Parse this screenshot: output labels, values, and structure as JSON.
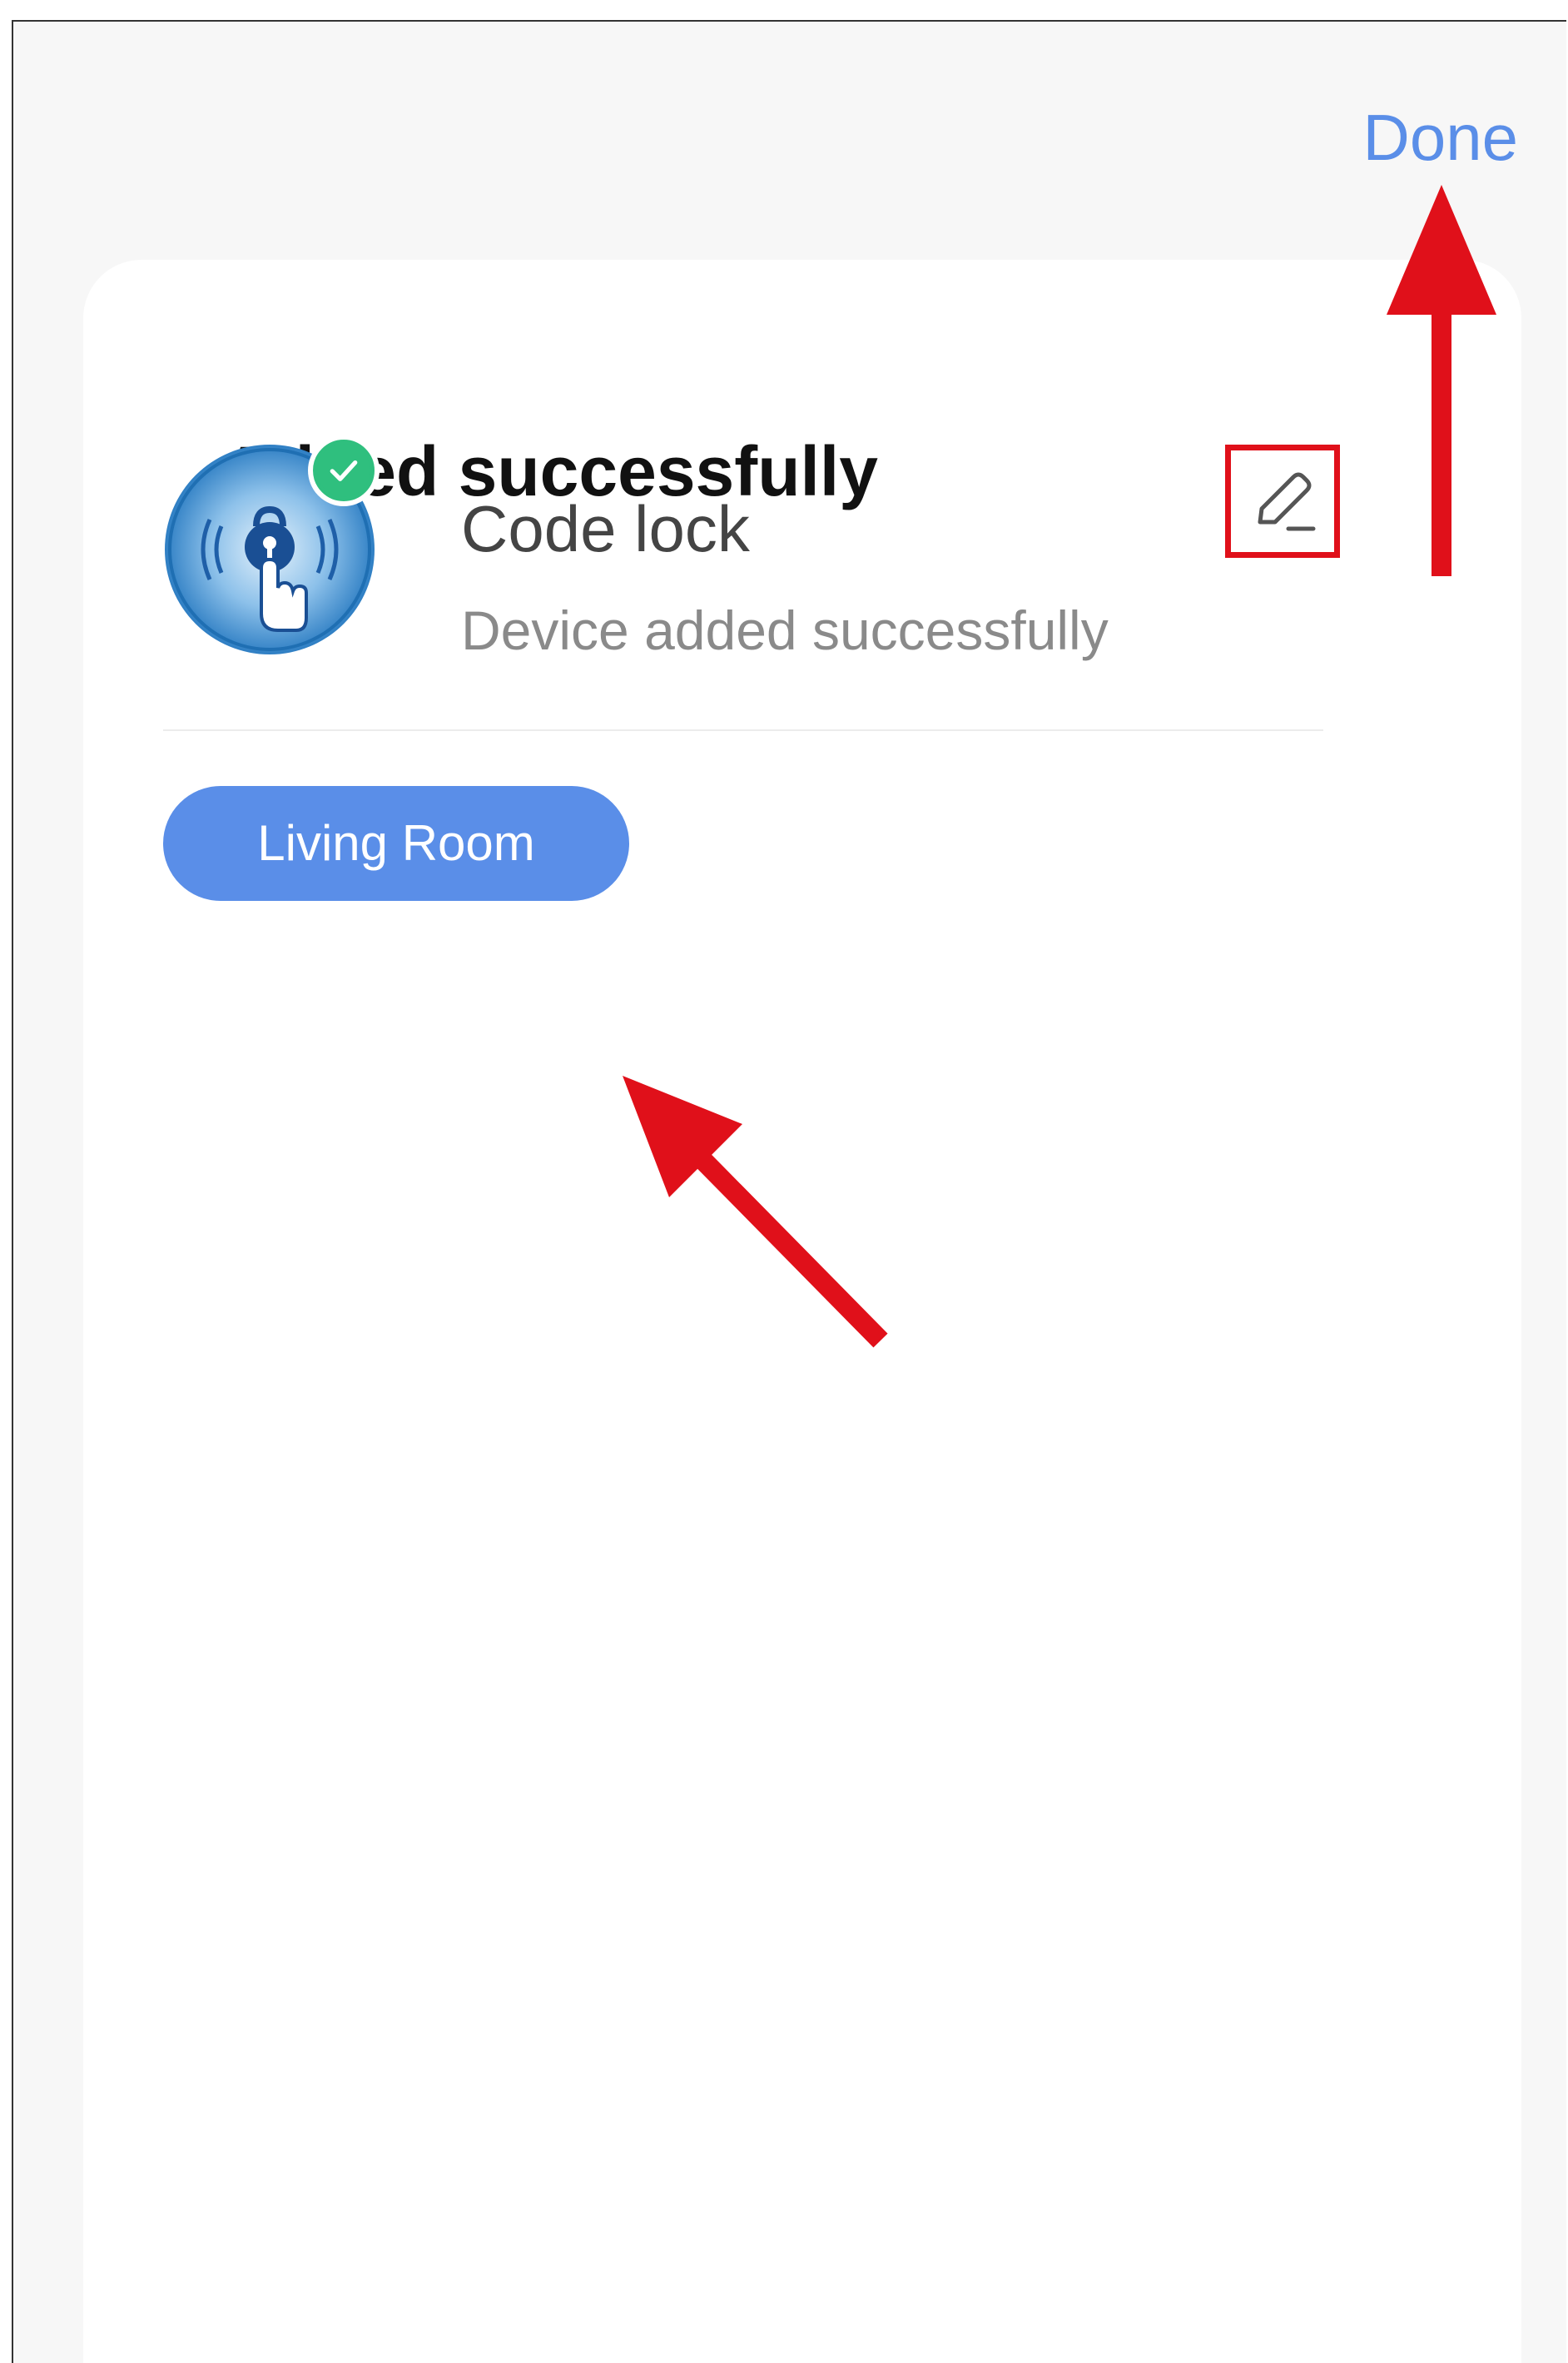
{
  "header": {
    "done_label": "Done"
  },
  "card": {
    "title": "Added successfully",
    "device": {
      "name": "Code lock",
      "status": "Device added successfully",
      "image_icon": "code-lock-device-icon",
      "badge_icon": "check-icon",
      "edit_icon": "pencil-icon"
    },
    "room_chip_label": "Living Room"
  },
  "colors": {
    "accent": "#5a8ee8",
    "success": "#2fbf7e",
    "annotation": "#e0101a"
  }
}
